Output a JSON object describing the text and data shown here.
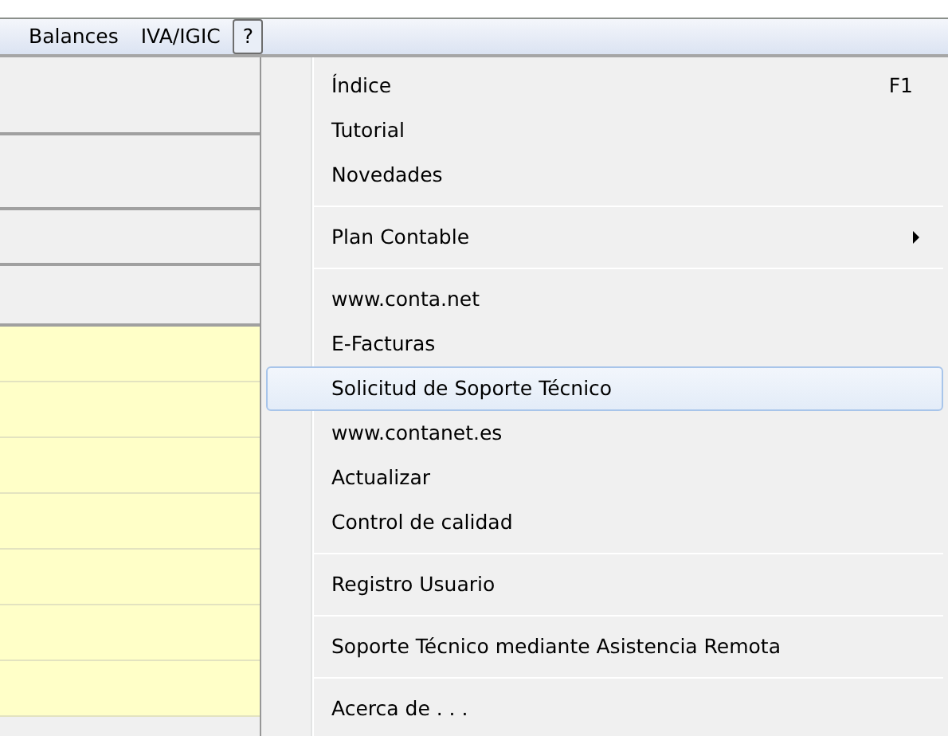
{
  "menu_bar": [
    {
      "label": "Balances",
      "selected": false
    },
    {
      "label": "IVA/IGIC",
      "selected": false
    },
    {
      "label": "?",
      "selected": true
    }
  ],
  "help_menu": {
    "groups": [
      [
        {
          "label": "Índice",
          "shortcut": "F1",
          "submenu": false,
          "selected": false
        },
        {
          "label": "Tutorial",
          "submenu": false,
          "selected": false
        },
        {
          "label": "Novedades",
          "submenu": false,
          "selected": false
        }
      ],
      [
        {
          "label": "Plan Contable",
          "submenu": true,
          "selected": false
        }
      ],
      [
        {
          "label": "www.conta.net",
          "submenu": false,
          "selected": false
        },
        {
          "label": "E-Facturas",
          "submenu": false,
          "selected": false
        },
        {
          "label": "Solicitud de Soporte Técnico",
          "submenu": false,
          "selected": true
        },
        {
          "label": "www.contanet.es",
          "submenu": false,
          "selected": false
        },
        {
          "label": "Actualizar",
          "submenu": false,
          "selected": false
        },
        {
          "label": "Control de calidad",
          "submenu": false,
          "selected": false
        }
      ],
      [
        {
          "label": "Registro Usuario",
          "submenu": false,
          "selected": false
        }
      ],
      [
        {
          "label": "Soporte Técnico mediante Asistencia Remota",
          "submenu": false,
          "selected": false
        }
      ],
      [
        {
          "label": "Acerca de . . .",
          "submenu": false,
          "selected": false
        }
      ]
    ]
  }
}
